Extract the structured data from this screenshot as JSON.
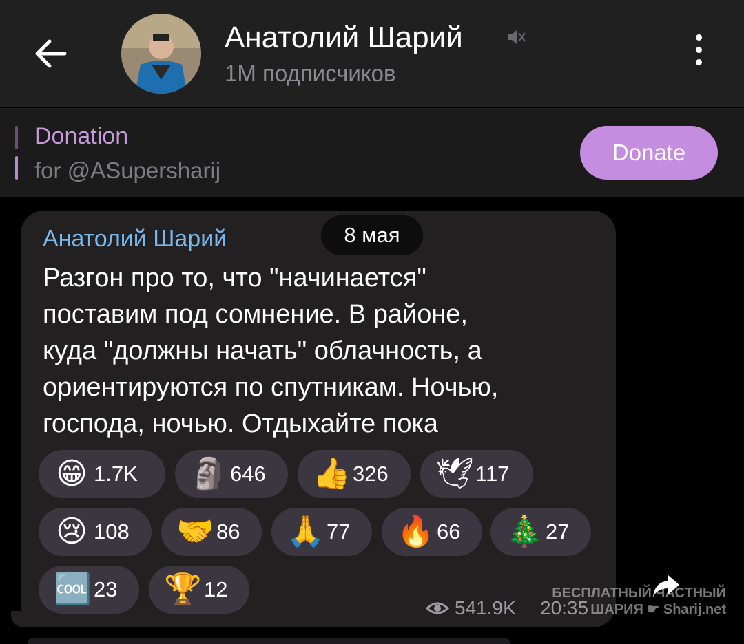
{
  "header": {
    "title": "Анатолий Шарий",
    "subtitle": "1M подписчиков"
  },
  "pinned": {
    "title": "Donation",
    "subtitle": "for @ASupersharij",
    "button_label": "Donate"
  },
  "message": {
    "sender": "Анатолий Шарий",
    "date": "8 мая",
    "lines": [
      "Разгон про то, что \"начинается\"",
      "поставим под сомнение. В районе,",
      "куда \"должны начать\" облачность, а",
      "ориентируются по спутникам. Ночью,",
      "господа, ночью. Отдыхайте пока"
    ],
    "reactions": [
      {
        "emoji": "😁",
        "count": "1.7K",
        "icon": "grin-icon"
      },
      {
        "emoji": "🗿",
        "count": "646",
        "icon": "moai-icon"
      },
      {
        "emoji": "👍",
        "count": "326",
        "icon": "thumbs-up-icon"
      },
      {
        "emoji": "🕊",
        "count": "117",
        "icon": "dove-icon"
      },
      {
        "emoji": "😢",
        "count": "108",
        "icon": "crying-icon"
      },
      {
        "emoji": "🤝",
        "count": "86",
        "icon": "handshake-icon"
      },
      {
        "emoji": "🙏",
        "count": "77",
        "icon": "pray-icon"
      },
      {
        "emoji": "🔥",
        "count": "66",
        "icon": "fire-icon"
      },
      {
        "emoji": "🎄",
        "count": "27",
        "icon": "christmas-tree-icon"
      },
      {
        "emoji": "🆒",
        "count": "23",
        "icon": "cool-icon"
      },
      {
        "emoji": "🏆",
        "count": "12",
        "icon": "trophy-icon"
      }
    ],
    "views": "541.9K",
    "time": "20:35"
  },
  "watermark": {
    "line1": "БЕСПЛАТНЫЙ ЧАСТНЫЙ",
    "line2": "ШАРИЯ ☛ Sharij.net"
  },
  "colors": {
    "header_bg": "#212021",
    "accent_purple": "#c48ddf",
    "sender_blue": "#7ab8ec",
    "bubble_bg": "#232022"
  }
}
